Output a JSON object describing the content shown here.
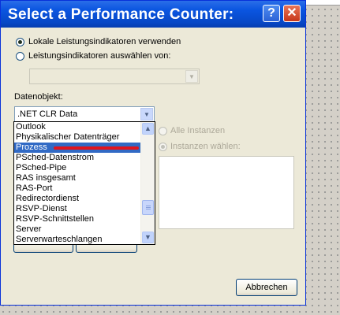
{
  "dialog": {
    "title": "Select a Performance Counter:",
    "help_icon": "?",
    "close_icon": "✕"
  },
  "source": {
    "local_label": "Lokale Leistungsindikatoren verwenden",
    "remote_label": "Leistungsindikatoren auswählen von:",
    "remote_value": ""
  },
  "object": {
    "label": "Datenobjekt:",
    "selected": ".NET CLR Data",
    "options": [
      "Outlook",
      "Physikalischer Datenträger",
      "Prozess",
      "PSched-Datenstrom",
      "PSched-Pipe",
      "RAS insgesamt",
      "RAS-Port",
      "Redirectordienst",
      "RSVP-Dienst",
      "RSVP-Schnittstellen",
      "Server",
      "Serverwarteschlangen"
    ],
    "highlighted": "Prozess"
  },
  "instances": {
    "all_label": "Alle Instanzen",
    "select_label": "Instanzen wählen:"
  },
  "buttons": {
    "cancel": "Abbrechen"
  },
  "colors": {
    "title_bar": "#0a55e0",
    "selection": "#316ac5",
    "annotation": "#e0141e"
  },
  "icons": {
    "dropdown": "chevron-down-icon",
    "scroll_up": "chevron-up-icon",
    "scroll_down": "chevron-down-icon"
  }
}
